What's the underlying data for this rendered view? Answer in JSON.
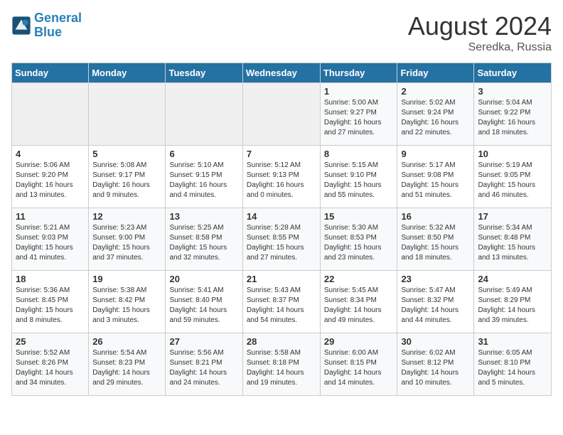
{
  "header": {
    "logo_line1": "General",
    "logo_line2": "Blue",
    "month": "August 2024",
    "location": "Seredka, Russia"
  },
  "days_of_week": [
    "Sunday",
    "Monday",
    "Tuesday",
    "Wednesday",
    "Thursday",
    "Friday",
    "Saturday"
  ],
  "weeks": [
    [
      {
        "num": "",
        "detail": ""
      },
      {
        "num": "",
        "detail": ""
      },
      {
        "num": "",
        "detail": ""
      },
      {
        "num": "",
        "detail": ""
      },
      {
        "num": "1",
        "detail": "Sunrise: 5:00 AM\nSunset: 9:27 PM\nDaylight: 16 hours\nand 27 minutes."
      },
      {
        "num": "2",
        "detail": "Sunrise: 5:02 AM\nSunset: 9:24 PM\nDaylight: 16 hours\nand 22 minutes."
      },
      {
        "num": "3",
        "detail": "Sunrise: 5:04 AM\nSunset: 9:22 PM\nDaylight: 16 hours\nand 18 minutes."
      }
    ],
    [
      {
        "num": "4",
        "detail": "Sunrise: 5:06 AM\nSunset: 9:20 PM\nDaylight: 16 hours\nand 13 minutes."
      },
      {
        "num": "5",
        "detail": "Sunrise: 5:08 AM\nSunset: 9:17 PM\nDaylight: 16 hours\nand 9 minutes."
      },
      {
        "num": "6",
        "detail": "Sunrise: 5:10 AM\nSunset: 9:15 PM\nDaylight: 16 hours\nand 4 minutes."
      },
      {
        "num": "7",
        "detail": "Sunrise: 5:12 AM\nSunset: 9:13 PM\nDaylight: 16 hours\nand 0 minutes."
      },
      {
        "num": "8",
        "detail": "Sunrise: 5:15 AM\nSunset: 9:10 PM\nDaylight: 15 hours\nand 55 minutes."
      },
      {
        "num": "9",
        "detail": "Sunrise: 5:17 AM\nSunset: 9:08 PM\nDaylight: 15 hours\nand 51 minutes."
      },
      {
        "num": "10",
        "detail": "Sunrise: 5:19 AM\nSunset: 9:05 PM\nDaylight: 15 hours\nand 46 minutes."
      }
    ],
    [
      {
        "num": "11",
        "detail": "Sunrise: 5:21 AM\nSunset: 9:03 PM\nDaylight: 15 hours\nand 41 minutes."
      },
      {
        "num": "12",
        "detail": "Sunrise: 5:23 AM\nSunset: 9:00 PM\nDaylight: 15 hours\nand 37 minutes."
      },
      {
        "num": "13",
        "detail": "Sunrise: 5:25 AM\nSunset: 8:58 PM\nDaylight: 15 hours\nand 32 minutes."
      },
      {
        "num": "14",
        "detail": "Sunrise: 5:28 AM\nSunset: 8:55 PM\nDaylight: 15 hours\nand 27 minutes."
      },
      {
        "num": "15",
        "detail": "Sunrise: 5:30 AM\nSunset: 8:53 PM\nDaylight: 15 hours\nand 23 minutes."
      },
      {
        "num": "16",
        "detail": "Sunrise: 5:32 AM\nSunset: 8:50 PM\nDaylight: 15 hours\nand 18 minutes."
      },
      {
        "num": "17",
        "detail": "Sunrise: 5:34 AM\nSunset: 8:48 PM\nDaylight: 15 hours\nand 13 minutes."
      }
    ],
    [
      {
        "num": "18",
        "detail": "Sunrise: 5:36 AM\nSunset: 8:45 PM\nDaylight: 15 hours\nand 8 minutes."
      },
      {
        "num": "19",
        "detail": "Sunrise: 5:38 AM\nSunset: 8:42 PM\nDaylight: 15 hours\nand 3 minutes."
      },
      {
        "num": "20",
        "detail": "Sunrise: 5:41 AM\nSunset: 8:40 PM\nDaylight: 14 hours\nand 59 minutes."
      },
      {
        "num": "21",
        "detail": "Sunrise: 5:43 AM\nSunset: 8:37 PM\nDaylight: 14 hours\nand 54 minutes."
      },
      {
        "num": "22",
        "detail": "Sunrise: 5:45 AM\nSunset: 8:34 PM\nDaylight: 14 hours\nand 49 minutes."
      },
      {
        "num": "23",
        "detail": "Sunrise: 5:47 AM\nSunset: 8:32 PM\nDaylight: 14 hours\nand 44 minutes."
      },
      {
        "num": "24",
        "detail": "Sunrise: 5:49 AM\nSunset: 8:29 PM\nDaylight: 14 hours\nand 39 minutes."
      }
    ],
    [
      {
        "num": "25",
        "detail": "Sunrise: 5:52 AM\nSunset: 8:26 PM\nDaylight: 14 hours\nand 34 minutes."
      },
      {
        "num": "26",
        "detail": "Sunrise: 5:54 AM\nSunset: 8:23 PM\nDaylight: 14 hours\nand 29 minutes."
      },
      {
        "num": "27",
        "detail": "Sunrise: 5:56 AM\nSunset: 8:21 PM\nDaylight: 14 hours\nand 24 minutes."
      },
      {
        "num": "28",
        "detail": "Sunrise: 5:58 AM\nSunset: 8:18 PM\nDaylight: 14 hours\nand 19 minutes."
      },
      {
        "num": "29",
        "detail": "Sunrise: 6:00 AM\nSunset: 8:15 PM\nDaylight: 14 hours\nand 14 minutes."
      },
      {
        "num": "30",
        "detail": "Sunrise: 6:02 AM\nSunset: 8:12 PM\nDaylight: 14 hours\nand 10 minutes."
      },
      {
        "num": "31",
        "detail": "Sunrise: 6:05 AM\nSunset: 8:10 PM\nDaylight: 14 hours\nand 5 minutes."
      }
    ]
  ]
}
